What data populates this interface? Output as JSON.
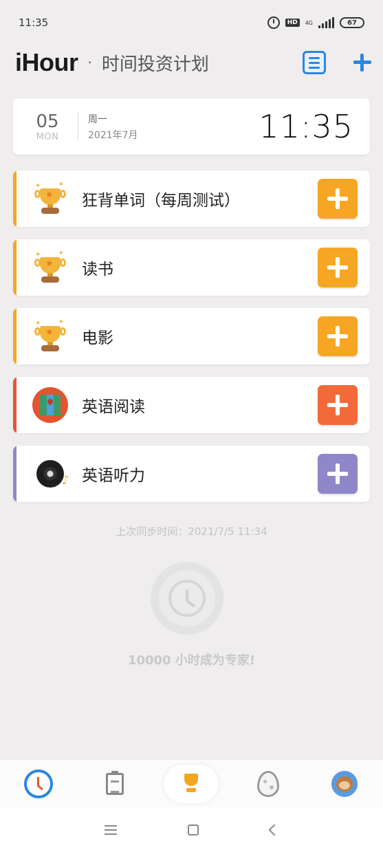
{
  "status_bar": {
    "time": "11:35",
    "hd_label": "HD",
    "network": "4G",
    "battery": "67"
  },
  "header": {
    "app_name": "iHour",
    "separator": "·",
    "subtitle": "时间投资计划"
  },
  "date_card": {
    "day": "05",
    "day_abbr": "MON",
    "weekday": "周一",
    "month": "2021年7月",
    "clock": "11:35"
  },
  "tasks": [
    {
      "name": "狂背单词（每周测试）",
      "icon": "trophy-icon",
      "color": "#f6a623"
    },
    {
      "name": "读书",
      "icon": "trophy-icon",
      "color": "#f6a623"
    },
    {
      "name": "电影",
      "icon": "trophy-icon",
      "color": "#f6a623"
    },
    {
      "name": "英语阅读",
      "icon": "map-icon",
      "color": "#f26a3a"
    },
    {
      "name": "英语听力",
      "icon": "vinyl-record-icon",
      "color": "#8f87c9"
    }
  ],
  "sync_text": "上次同步时间：2021/7/5 11:34",
  "expert_text": "10000 小时成为专家!",
  "tabbar": [
    {
      "name": "clock-icon",
      "active": false
    },
    {
      "name": "clipboard-icon",
      "active": false
    },
    {
      "name": "trophy-icon",
      "active": true
    },
    {
      "name": "egg-icon",
      "active": false
    },
    {
      "name": "monkey-avatar-icon",
      "active": false
    }
  ],
  "colors": {
    "accent": "#2a86e0",
    "background": "#efeded"
  }
}
